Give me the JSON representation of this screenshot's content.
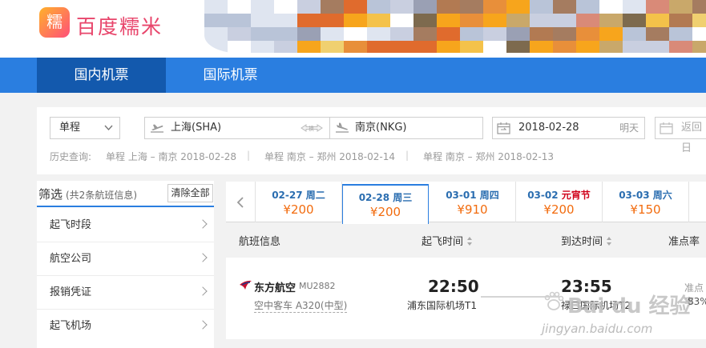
{
  "brand": {
    "logo_glyph": "糯",
    "name": "百度糯米"
  },
  "nav": {
    "domestic": "国内机票",
    "international": "国际机票"
  },
  "search": {
    "trip_type": "单程",
    "from_city": "上海(SHA)",
    "to_city": "南京(NKG)",
    "depart_date": "2018-02-28",
    "depart_day_hint": "明天",
    "return_label": "返回日",
    "history_label": "历史查询:",
    "history": [
      "单程 上海 – 南京 2018-02-28",
      "单程 南京 – 郑州 2018-02-14",
      "单程 南京 – 郑州 2018-02-13"
    ]
  },
  "filter": {
    "title": "筛选",
    "count_note": "(共2条航班信息)",
    "clear_all": "清除全部",
    "rows": [
      "起飞时段",
      "航空公司",
      "报销凭证",
      "起飞机场"
    ]
  },
  "dates": [
    {
      "date": "02-27",
      "week": "周二",
      "festival": "",
      "price": "¥200"
    },
    {
      "date": "02-28",
      "week": "周三",
      "festival": "",
      "price": "¥200"
    },
    {
      "date": "03-01",
      "week": "周四",
      "festival": "",
      "price": "¥910"
    },
    {
      "date": "03-02",
      "week": "",
      "festival": "元宵节",
      "price": "¥200"
    },
    {
      "date": "03-03",
      "week": "周六",
      "festival": "",
      "price": "¥150"
    }
  ],
  "table": {
    "col_flight": "航班信息",
    "col_depart": "起飞时间",
    "col_arrive": "到达时间",
    "col_ontime": "准点率"
  },
  "flight": {
    "airline": "东方航空",
    "flight_no": "MU2882",
    "aircraft": "空中客车 A320(中型)",
    "depart_time": "22:50",
    "depart_airport": "浦东国际机场T1",
    "arrive_time": "23:55",
    "arrive_airport": "禄口国际机场T2",
    "ontime_label": "准点率",
    "ontime_value": "83%"
  },
  "watermark": {
    "line1": "Bai du 经验",
    "line2": "jingyan.baidu.com"
  },
  "colors": {
    "nav_blue": "#2a7ee0",
    "nav_active": "#1359ad",
    "price_orange": "#f26c0f",
    "festival_red": "#d0021b"
  },
  "icons": [
    "plane-takeoff-icon",
    "plane-landing-icon",
    "swap-icon",
    "calendar-icon",
    "chevron-down-icon",
    "chevron-right-icon",
    "chevron-left-icon",
    "sort-icon",
    "china-eastern-logo-icon"
  ]
}
